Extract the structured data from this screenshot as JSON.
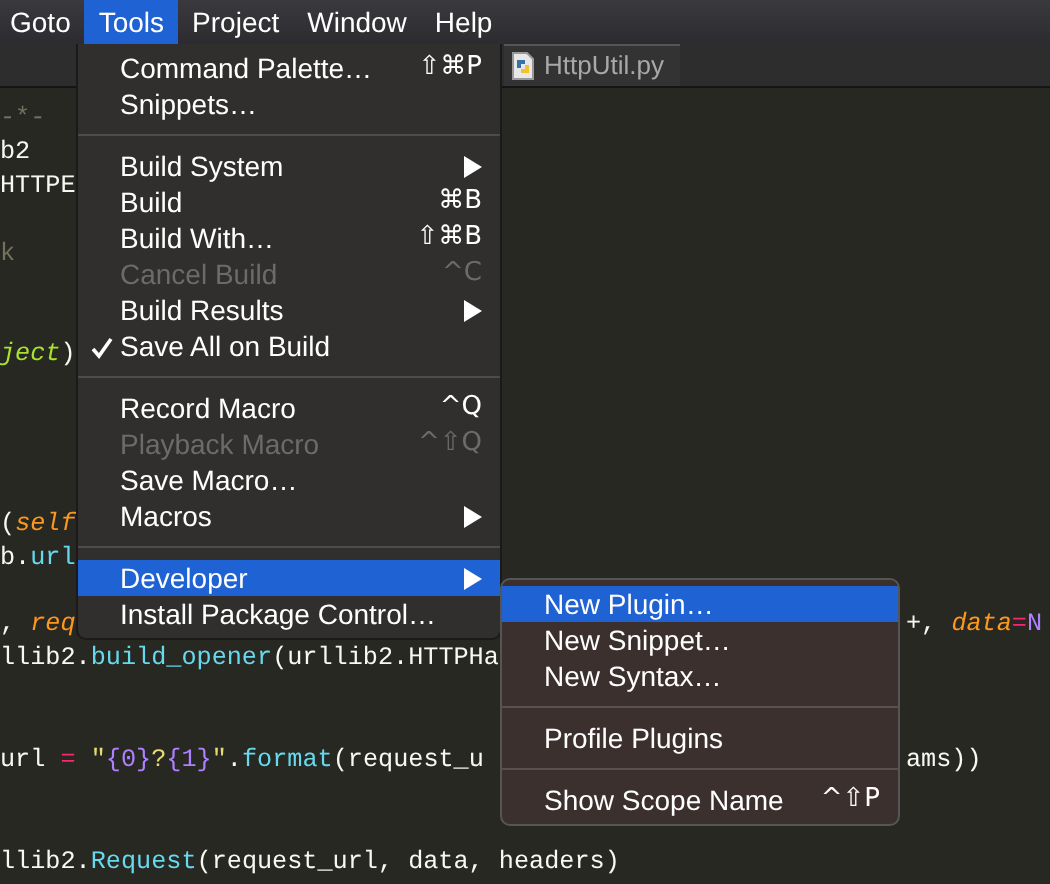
{
  "menu_bar": [
    {
      "label": "Goto",
      "selected": false
    },
    {
      "label": "Tools",
      "selected": true
    },
    {
      "label": "Project",
      "selected": false
    },
    {
      "label": "Window",
      "selected": false
    },
    {
      "label": "Help",
      "selected": false
    }
  ],
  "tab": {
    "label": "HttpUtil.py"
  },
  "editor_lines": [
    {
      "kind": "code",
      "left": [
        {
          "kind": "comment",
          "text": "-*-"
        }
      ]
    },
    {
      "kind": "code",
      "left": [
        {
          "kind": "plain",
          "text": "b2"
        }
      ]
    },
    {
      "kind": "code",
      "left": [
        {
          "kind": "plain",
          "text": "HTTPE"
        }
      ]
    },
    {
      "kind": "hidden"
    },
    {
      "kind": "code",
      "left": [
        {
          "kind": "comment",
          "text": "k"
        }
      ]
    },
    {
      "kind": "hidden"
    },
    {
      "kind": "hidden"
    },
    {
      "kind": "code",
      "left": [
        {
          "kind": "inherited",
          "text": "ject"
        },
        {
          "kind": "plain",
          "text": ")"
        }
      ]
    },
    {
      "kind": "hidden"
    },
    {
      "kind": "hidden"
    },
    {
      "kind": "hidden"
    },
    {
      "kind": "hidden"
    },
    {
      "kind": "code",
      "left": [
        {
          "kind": "plain",
          "text": "("
        },
        {
          "kind": "param",
          "text": "self"
        }
      ]
    },
    {
      "kind": "code",
      "left": [
        {
          "kind": "plain",
          "text": "b."
        },
        {
          "kind": "function",
          "text": "url"
        }
      ]
    },
    {
      "kind": "hidden"
    },
    {
      "kind": "code",
      "left": [
        {
          "kind": "plain",
          "text": ", "
        },
        {
          "kind": "param",
          "text": "req"
        }
      ],
      "right": [
        {
          "kind": "plain",
          "text": "+, "
        },
        {
          "kind": "param",
          "text": "data"
        },
        {
          "kind": "operator",
          "text": "="
        },
        {
          "kind": "constant",
          "text": "N"
        }
      ]
    },
    {
      "kind": "code",
      "left": [
        {
          "kind": "plain",
          "text": "llib2."
        },
        {
          "kind": "function",
          "text": "build_opener"
        },
        {
          "kind": "plain",
          "text": "(urllib2.HTTPHa"
        }
      ]
    },
    {
      "kind": "hidden"
    },
    {
      "kind": "hidden"
    },
    {
      "kind": "code",
      "left": [
        {
          "kind": "plain",
          "text": "url "
        },
        {
          "kind": "operator",
          "text": "="
        },
        {
          "kind": "string",
          "text": " \""
        },
        {
          "kind": "constant",
          "text": "{0}"
        },
        {
          "kind": "string",
          "text": "?"
        },
        {
          "kind": "constant",
          "text": "{1}"
        },
        {
          "kind": "string",
          "text": "\""
        },
        {
          "kind": "plain",
          "text": "."
        },
        {
          "kind": "function",
          "text": "format"
        },
        {
          "kind": "plain",
          "text": "(request_u"
        }
      ],
      "right": [
        {
          "kind": "plain",
          "text": "ams))"
        }
      ]
    },
    {
      "kind": "hidden"
    },
    {
      "kind": "hidden"
    },
    {
      "kind": "code",
      "left": [
        {
          "kind": "plain",
          "text": "llib2."
        },
        {
          "kind": "function",
          "text": "Request"
        },
        {
          "kind": "plain",
          "text": "(request_url, data, headers)"
        }
      ]
    }
  ],
  "tools_menu": [
    {
      "kind": "item",
      "label": "Command Palette…",
      "shortcut": "⇧⌘P",
      "submenu": false,
      "checked": false,
      "disabled": false,
      "selected": false
    },
    {
      "kind": "item",
      "label": "Snippets…",
      "submenu": false,
      "checked": false,
      "disabled": false,
      "selected": false
    },
    {
      "kind": "separator"
    },
    {
      "kind": "item",
      "label": "Build System",
      "submenu": true,
      "checked": false,
      "disabled": false,
      "selected": false
    },
    {
      "kind": "item",
      "label": "Build",
      "shortcut": "⌘B",
      "submenu": false,
      "checked": false,
      "disabled": false,
      "selected": false
    },
    {
      "kind": "item",
      "label": "Build With…",
      "shortcut": "⇧⌘B",
      "submenu": false,
      "checked": false,
      "disabled": false,
      "selected": false
    },
    {
      "kind": "item",
      "label": "Cancel Build",
      "shortcut": "^C",
      "submenu": false,
      "checked": false,
      "disabled": true,
      "selected": false
    },
    {
      "kind": "item",
      "label": "Build Results",
      "submenu": true,
      "checked": false,
      "disabled": false,
      "selected": false
    },
    {
      "kind": "item",
      "label": "Save All on Build",
      "submenu": false,
      "checked": true,
      "disabled": false,
      "selected": false
    },
    {
      "kind": "separator"
    },
    {
      "kind": "item",
      "label": "Record Macro",
      "shortcut": "^Q",
      "submenu": false,
      "checked": false,
      "disabled": false,
      "selected": false
    },
    {
      "kind": "item",
      "label": "Playback Macro",
      "shortcut": "^⇧Q",
      "submenu": false,
      "checked": false,
      "disabled": true,
      "selected": false
    },
    {
      "kind": "item",
      "label": "Save Macro…",
      "submenu": false,
      "checked": false,
      "disabled": false,
      "selected": false
    },
    {
      "kind": "item",
      "label": "Macros",
      "submenu": true,
      "checked": false,
      "disabled": false,
      "selected": false
    },
    {
      "kind": "separator"
    },
    {
      "kind": "item",
      "label": "Developer",
      "submenu": true,
      "checked": false,
      "disabled": false,
      "selected": true
    },
    {
      "kind": "item",
      "label": "Install Package Control…",
      "submenu": false,
      "checked": false,
      "disabled": false,
      "selected": false
    }
  ],
  "developer_submenu": [
    {
      "kind": "item",
      "label": "New Plugin…",
      "submenu": false,
      "checked": false,
      "disabled": false,
      "selected": true
    },
    {
      "kind": "item",
      "label": "New Snippet…",
      "submenu": false,
      "checked": false,
      "disabled": false,
      "selected": false
    },
    {
      "kind": "item",
      "label": "New Syntax…",
      "submenu": false,
      "checked": false,
      "disabled": false,
      "selected": false
    },
    {
      "kind": "separator"
    },
    {
      "kind": "item",
      "label": "Profile Plugins",
      "submenu": false,
      "checked": false,
      "disabled": false,
      "selected": false
    },
    {
      "kind": "separator"
    },
    {
      "kind": "item",
      "label": "Show Scope Name",
      "shortcut": "^⇧P",
      "submenu": false,
      "checked": false,
      "disabled": false,
      "selected": false
    }
  ]
}
